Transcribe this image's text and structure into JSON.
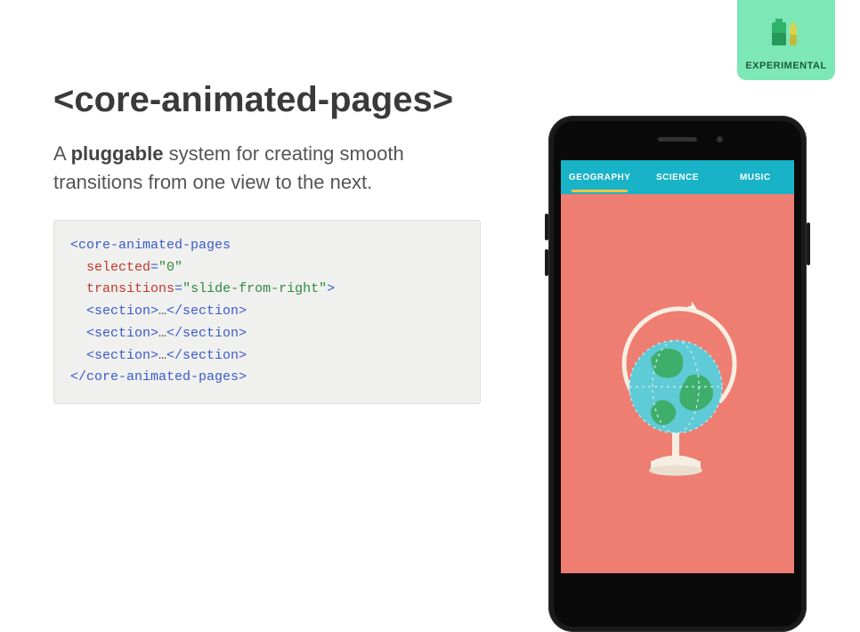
{
  "badge": {
    "label": "EXPERIMENTAL"
  },
  "title": "<core-animated-pages>",
  "subtitle": {
    "pre": "A ",
    "bold": "pluggable",
    "post": " system for creating smooth transitions from one view to the next."
  },
  "code": {
    "open_tag": "core-animated-pages",
    "attr1_name": "selected",
    "attr1_val": "\"0\"",
    "attr2_name": "transitions",
    "attr2_val": "\"slide-from-right\"",
    "section_open": "<section>",
    "section_ellipsis": "…",
    "section_close": "</section>",
    "close_tag": "</core-animated-pages>"
  },
  "phone": {
    "tabs": [
      {
        "label": "GEOGRAPHY",
        "active": true
      },
      {
        "label": "SCIENCE",
        "active": false
      },
      {
        "label": "MUSIC",
        "active": false
      }
    ]
  }
}
